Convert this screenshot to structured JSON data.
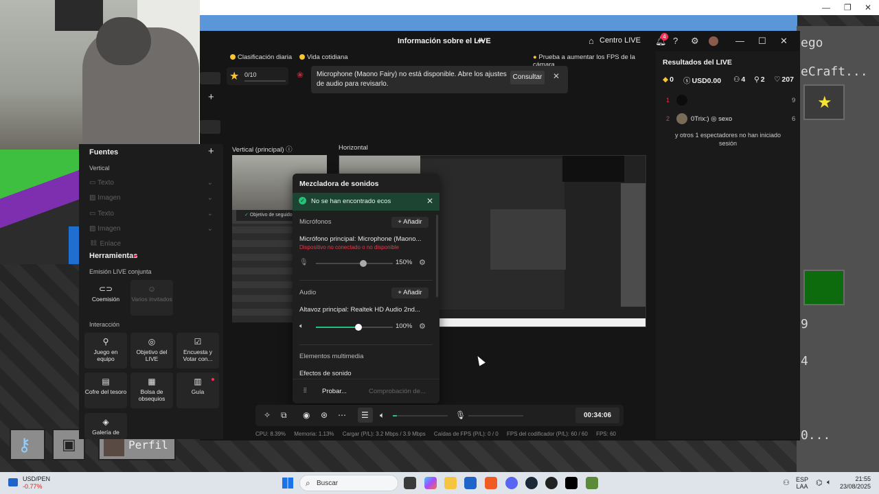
{
  "window": {
    "title": "Información sobre el LIVE",
    "centro_live": "Centro LIVE",
    "notifications_count": "4"
  },
  "goalbar": {
    "daily_ranking": "Clasificación diaria",
    "daily_life": "Vida cotidiana",
    "fps_tip": "Prueba a aumentar los FPS de la cámara",
    "goal_count": "0/10"
  },
  "toast": {
    "message": "Microphone (Maono Fairy) no está disponible. Abre los ajustes de audio para revisarlo.",
    "button": "Consultar"
  },
  "previews": {
    "vertical_label": "Vertical (principal)",
    "horizontal_label": "Horizontal",
    "follower_goal": "Objetivo de seguidore"
  },
  "sidepanel": {
    "sources_heading": "Fuentes",
    "vertical_label": "Vertical",
    "rows": [
      "Texto",
      "Imagen",
      "Texto",
      "Imagen",
      "Enlace"
    ],
    "tools_heading": "Herramientas",
    "joint_label": "Emisión LIVE conjunta",
    "joint_tools": [
      {
        "label": "Coemisión",
        "icon": "link-icon",
        "enabled": true
      },
      {
        "label": "Varios invitados",
        "icon": "guests-icon",
        "enabled": false
      }
    ],
    "interaction_label": "Interacción",
    "interaction_tools": [
      {
        "label": "Juego en equipo",
        "icon": "joystick-icon"
      },
      {
        "label": "Objetivo del LIVE",
        "icon": "target-icon"
      },
      {
        "label": "Encuesta y Votar con...",
        "icon": "poll-icon"
      },
      {
        "label": "Cofre del tesoro",
        "icon": "chest-icon"
      },
      {
        "label": "Bolsa de obsequios",
        "icon": "gift-bag-icon"
      },
      {
        "label": "Guía",
        "icon": "book-icon"
      },
      {
        "label": "Galería de",
        "icon": "gallery-icon"
      }
    ]
  },
  "mixer": {
    "title": "Mezcladora de sonidos",
    "banner": "No se han encontrado ecos",
    "mic_section": "Micrófonos",
    "add_label": "Añadir",
    "mic_device": "Micrófono principal: Microphone (Maono...",
    "mic_error": "Dispositivo no conectado o no disponible",
    "mic_volume": "150%",
    "mic_level": 0.62,
    "audio_section": "Audio",
    "audio_device": "Altavoz principal: Realtek HD Audio 2nd...",
    "audio_volume": "100%",
    "audio_level": 0.55,
    "media_section": "Elementos multimedia",
    "sound_effects": "Efectos de sonido",
    "test_label": "Probar...",
    "check_label": "Comprobación de..."
  },
  "controls": {
    "timer": "00:34:06"
  },
  "status": {
    "cpu": "CPU: 8.39%",
    "memory": "Memoria: 1.13%",
    "load": "Cargar (P/L): 3.2 Mbps / 3.9 Mbps",
    "fps_drop": "Caídas de FPS (P/L): 0 / 0",
    "encoder_fps": "FPS del codificador (P/L): 60 / 60",
    "fps": "FPS: 60"
  },
  "results": {
    "title": "Resultados del LIVE",
    "coins": "0",
    "usd": "USD0.00",
    "viewers": "4",
    "new_followers": "2",
    "likes": "207",
    "ranking": [
      {
        "rank": "1",
        "name": "",
        "score": "9"
      },
      {
        "rank": "2",
        "name": "0Trix:) ◎ sexo",
        "score": "6"
      }
    ],
    "others": "y otros 1 espectadores no han iniciado sesión"
  },
  "game": {
    "right_texts": [
      "ego",
      "eCraft...",
      "9",
      "4",
      "0..."
    ],
    "hotbar_name": "Perfil"
  },
  "taskbar": {
    "ticker_name": "USD/PEN",
    "ticker_change": "-0.77%",
    "search": "Buscar",
    "lang": "ESP",
    "lang_sub": "LAA",
    "time": "21:55",
    "date": "23/08/2025"
  },
  "colors": {
    "accent_green": "#27c27a",
    "error_red": "#e23b4b",
    "badge_pink": "#fe2c55"
  }
}
